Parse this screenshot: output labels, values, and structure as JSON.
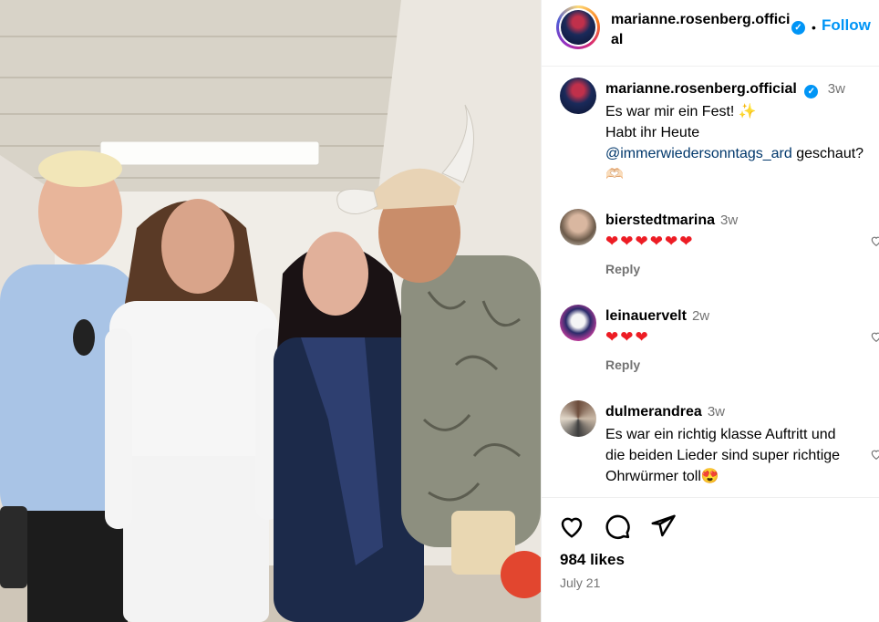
{
  "post": {
    "username": "marianne.rosenberg.official",
    "header_username": "marianne.rosenberg.official",
    "verified_mark": "✓",
    "separator": "•",
    "follow_label": "Follow"
  },
  "caption": {
    "username": "marianne.rosenberg.official",
    "time": "3w",
    "line1": "Es war mir ein Fest! ✨",
    "line2": "Habt ihr Heute",
    "mention": "@immerwiedersonntags_ard",
    "line3_rest": " geschaut?",
    "line4": "🫶🏻"
  },
  "comments": [
    {
      "username": "bierstedtmarina",
      "time": "3w",
      "text": "❤❤❤❤❤❤",
      "reply": "Reply"
    },
    {
      "username": "leinauervelt",
      "time": "2w",
      "text": "❤❤❤",
      "reply": "Reply"
    },
    {
      "username": "dulmerandrea",
      "time": "3w",
      "text_lines": [
        "Es war ein richtig klasse Auftritt und",
        "die beiden Lieder sind super richtige",
        "Ohrwürmer toll😍"
      ]
    }
  ],
  "footer": {
    "likes": "984 likes",
    "date": "July 21"
  },
  "icons": {
    "like": "heart-outline-icon",
    "comment": "comment-bubble-icon",
    "share": "paper-plane-icon",
    "verified": "verified-badge-icon"
  },
  "colors": {
    "accent": "#0095f6",
    "secondary_text": "#737373",
    "mention": "#00376b",
    "heart": "#ed1c24"
  }
}
